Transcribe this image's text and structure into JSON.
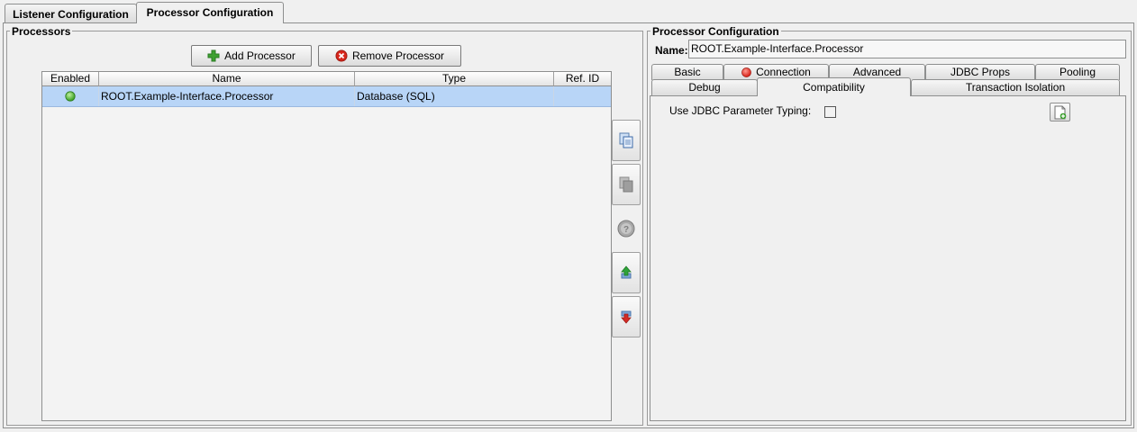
{
  "top_tabs": [
    "Listener Configuration",
    "Processor Configuration"
  ],
  "processors": {
    "group_title": "Processors",
    "add_button": "Add Processor",
    "remove_button": "Remove Processor",
    "columns": [
      "Enabled",
      "Name",
      "Type",
      "Ref. ID"
    ],
    "rows": [
      {
        "enabled": true,
        "name": "ROOT.Example-Interface.Processor",
        "type": "Database (SQL)",
        "ref_id": ""
      }
    ],
    "side_buttons": [
      "copy-icon",
      "copy-disabled-icon",
      "help-icon",
      "move-up-icon",
      "move-down-icon"
    ]
  },
  "config": {
    "group_title": "Processor Configuration",
    "name_label": "Name:",
    "name_value": "ROOT.Example-Interface.Processor",
    "tabs_row1": [
      "Basic",
      "Connection",
      "Advanced",
      "JDBC Props",
      "Pooling"
    ],
    "tabs_row2": [
      "Debug",
      "Compatibility",
      "Transaction Isolation"
    ],
    "active_tab": "Compatibility",
    "jdbc_param_label": "Use JDBC Parameter Typing:",
    "jdbc_param_checked": false
  },
  "colors": {
    "selected_row": "#b8d5f7",
    "enabled_green": "#3fa329",
    "error_red": "#d9261c",
    "add_green": "#3ea131"
  }
}
